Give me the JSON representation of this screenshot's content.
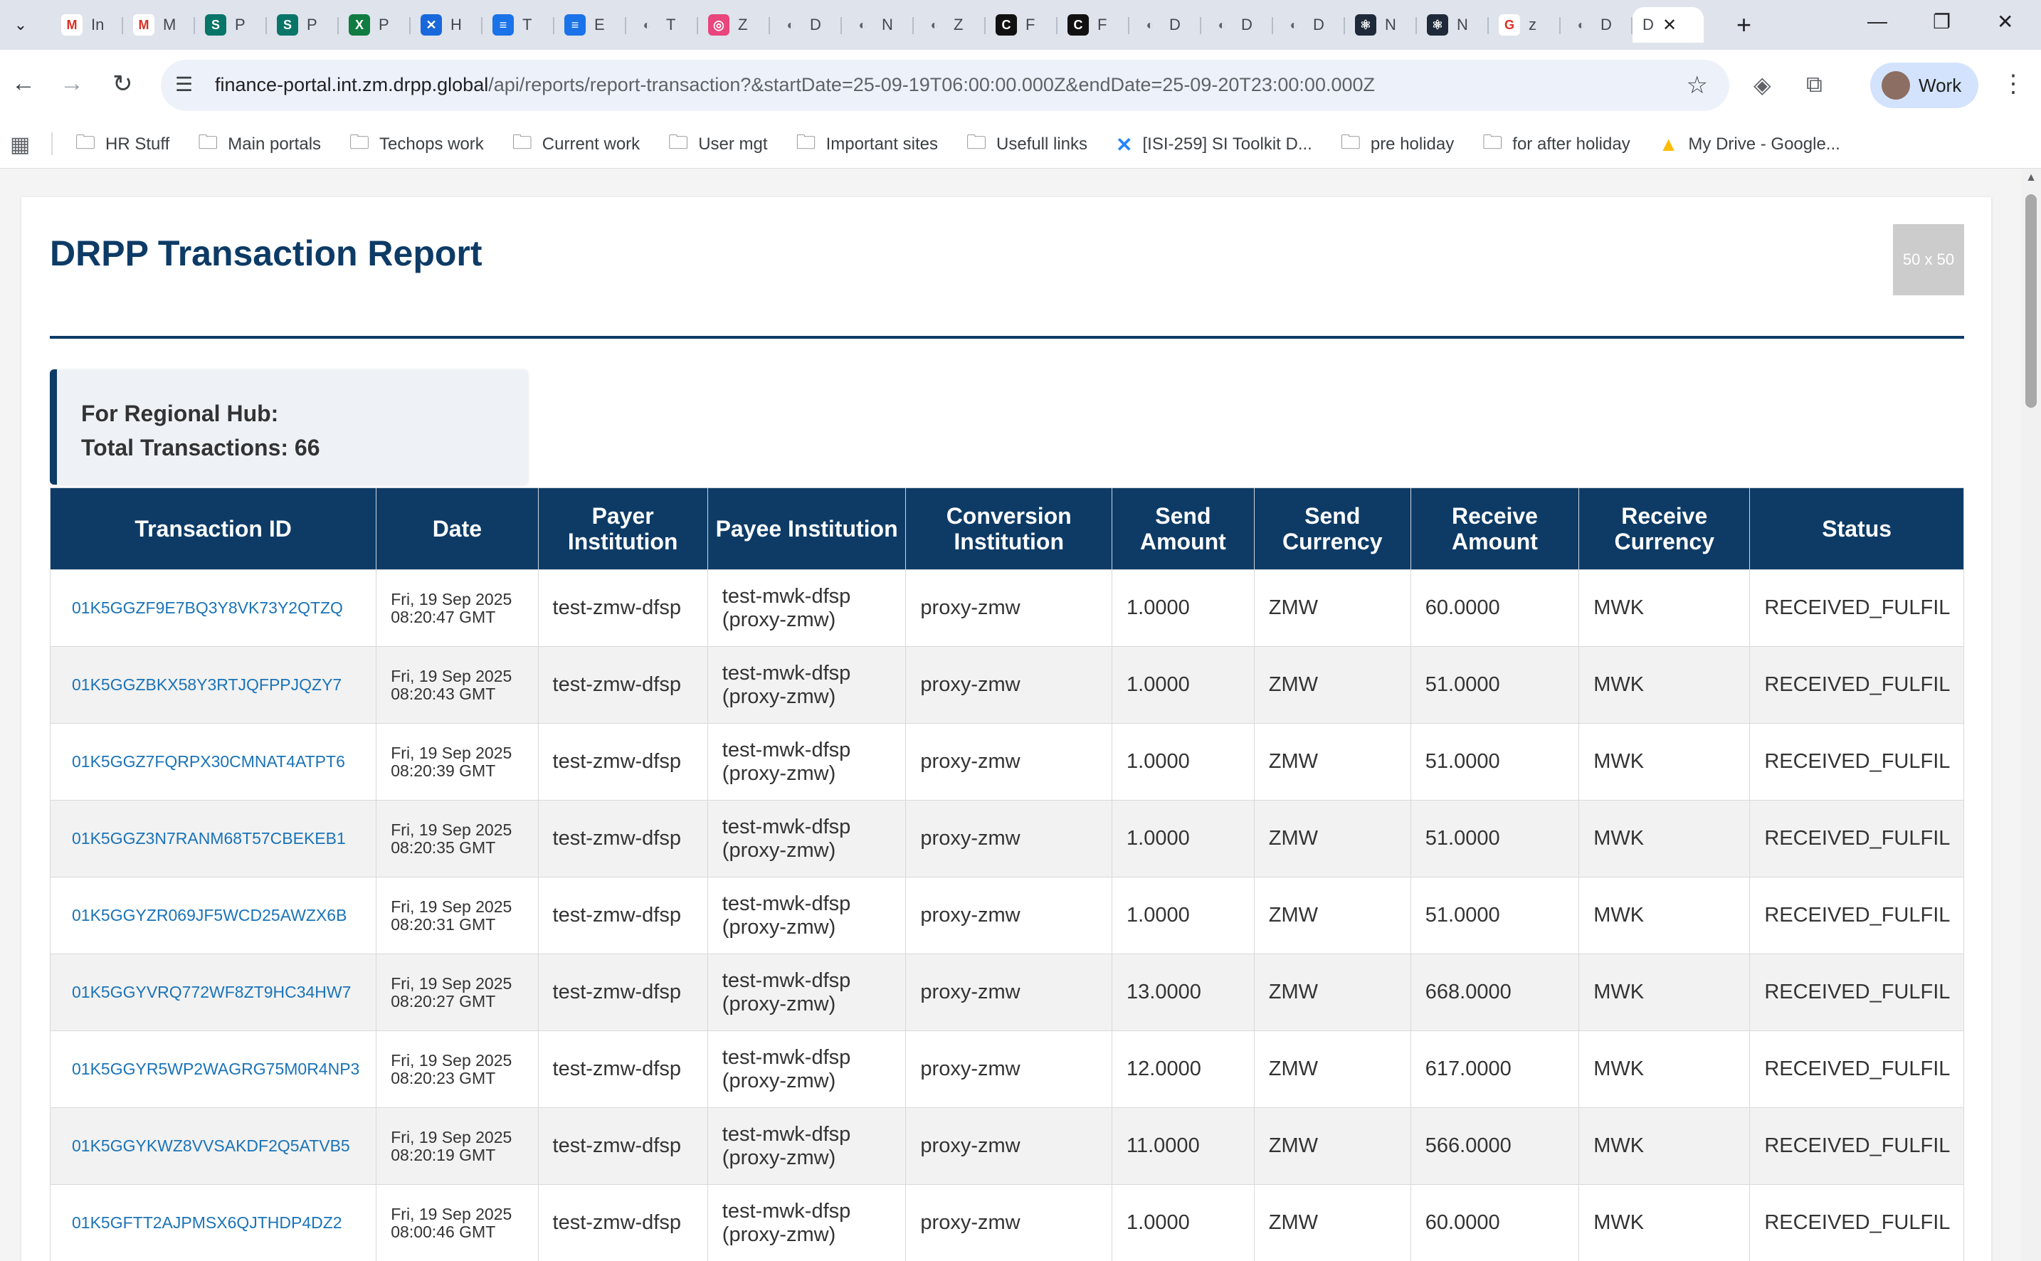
{
  "browser": {
    "tabs": [
      {
        "icon": "gmail-icon",
        "color": "#ffffff",
        "glyph": "M",
        "title": "In"
      },
      {
        "icon": "record-icon",
        "color": "#ffffff",
        "glyph": "M",
        "title": "M"
      },
      {
        "icon": "sharepoint-icon",
        "color": "#077568",
        "glyph": "S",
        "title": "P"
      },
      {
        "icon": "sharepoint-icon",
        "color": "#077568",
        "glyph": "S",
        "title": "P"
      },
      {
        "icon": "excel-icon",
        "color": "#107c41",
        "glyph": "X",
        "title": "P"
      },
      {
        "icon": "jira-icon",
        "color": "#1868db",
        "glyph": "✕",
        "title": "H"
      },
      {
        "icon": "doc-icon",
        "color": "#1a73e8",
        "glyph": "≡",
        "title": "T"
      },
      {
        "icon": "doc-icon",
        "color": "#1a73e8",
        "glyph": "≡",
        "title": "E"
      },
      {
        "icon": "globe-icon",
        "color": "#5f6368",
        "glyph": "◐",
        "title": "T"
      },
      {
        "icon": "app-icon",
        "color": "#e8467c",
        "glyph": "◎",
        "title": "Z"
      },
      {
        "icon": "globe-icon",
        "color": "#5f6368",
        "glyph": "◐",
        "title": "D"
      },
      {
        "icon": "globe-icon",
        "color": "#5f6368",
        "glyph": "◐",
        "title": "N"
      },
      {
        "icon": "globe-icon",
        "color": "#5f6368",
        "glyph": "◐",
        "title": "Z"
      },
      {
        "icon": "app-icon",
        "color": "#111111",
        "glyph": "C",
        "title": "F"
      },
      {
        "icon": "app-icon",
        "color": "#111111",
        "glyph": "C",
        "title": "F"
      },
      {
        "icon": "globe-icon",
        "color": "#5f6368",
        "glyph": "◐",
        "title": "D"
      },
      {
        "icon": "globe-icon",
        "color": "#5f6368",
        "glyph": "◐",
        "title": "D"
      },
      {
        "icon": "globe-icon",
        "color": "#5f6368",
        "glyph": "◐",
        "title": "D"
      },
      {
        "icon": "react-icon",
        "color": "#1e2a3a",
        "glyph": "⚛",
        "title": "N"
      },
      {
        "icon": "react-icon",
        "color": "#1e2a3a",
        "glyph": "⚛",
        "title": "N"
      },
      {
        "icon": "google-icon",
        "color": "#ffffff",
        "glyph": "G",
        "title": "z"
      },
      {
        "icon": "globe-icon",
        "color": "#5f6368",
        "glyph": "◐",
        "title": "D"
      }
    ],
    "active_tab_title": "D",
    "url_host": "finance-portal.int.zm.drpp.global",
    "url_path": "/api/reports/report-transaction?&startDate=25-09-19T06:00:00.000Z&endDate=25-09-20T23:00:00.000Z",
    "profile_label": "Work",
    "bookmarks": [
      {
        "icon": "folder-icon",
        "label": "HR Stuff"
      },
      {
        "icon": "folder-icon",
        "label": "Main portals"
      },
      {
        "icon": "folder-icon",
        "label": "Techops work"
      },
      {
        "icon": "folder-icon",
        "label": "Current work"
      },
      {
        "icon": "folder-icon",
        "label": "User mgt"
      },
      {
        "icon": "folder-icon",
        "label": "Important sites"
      },
      {
        "icon": "folder-icon",
        "label": "Usefull links"
      },
      {
        "icon": "jira-icon",
        "label": "[ISI-259] SI Toolkit D..."
      },
      {
        "icon": "folder-icon",
        "label": "pre holiday"
      },
      {
        "icon": "folder-icon",
        "label": "for after holiday"
      },
      {
        "icon": "drive-icon",
        "label": "My Drive - Google..."
      }
    ]
  },
  "report": {
    "title": "DRPP Transaction Report",
    "logo_placeholder": "50 x 50",
    "summary_hub": "For Regional Hub:",
    "summary_total": "Total Transactions: 66",
    "columns": [
      "Transaction ID",
      "Date",
      "Payer Institution",
      "Payee Institution",
      "Conversion Institution",
      "Send Amount",
      "Send Currency",
      "Receive Amount",
      "Receive Currency",
      "Status"
    ],
    "rows": [
      {
        "id": "01K5GGZF9E7BQ3Y8VK73Y2QTZQ",
        "date1": "Fri, 19 Sep 2025",
        "date2": "08:20:47 GMT",
        "payer": "test-zmw-dfsp",
        "payee1": "test-mwk-dfsp",
        "payee2": "(proxy-zmw)",
        "conversion": "proxy-zmw",
        "send_amount": "1.0000",
        "send_currency": "ZMW",
        "receive_amount": "60.0000",
        "receive_currency": "MWK",
        "status": "RECEIVED_FULFIL"
      },
      {
        "id": "01K5GGZBKX58Y3RTJQFPPJQZY7",
        "date1": "Fri, 19 Sep 2025",
        "date2": "08:20:43 GMT",
        "payer": "test-zmw-dfsp",
        "payee1": "test-mwk-dfsp",
        "payee2": "(proxy-zmw)",
        "conversion": "proxy-zmw",
        "send_amount": "1.0000",
        "send_currency": "ZMW",
        "receive_amount": "51.0000",
        "receive_currency": "MWK",
        "status": "RECEIVED_FULFIL"
      },
      {
        "id": "01K5GGZ7FQRPX30CMNAT4ATPT6",
        "date1": "Fri, 19 Sep 2025",
        "date2": "08:20:39 GMT",
        "payer": "test-zmw-dfsp",
        "payee1": "test-mwk-dfsp",
        "payee2": "(proxy-zmw)",
        "conversion": "proxy-zmw",
        "send_amount": "1.0000",
        "send_currency": "ZMW",
        "receive_amount": "51.0000",
        "receive_currency": "MWK",
        "status": "RECEIVED_FULFIL"
      },
      {
        "id": "01K5GGZ3N7RANM68T57CBEKEB1",
        "date1": "Fri, 19 Sep 2025",
        "date2": "08:20:35 GMT",
        "payer": "test-zmw-dfsp",
        "payee1": "test-mwk-dfsp",
        "payee2": "(proxy-zmw)",
        "conversion": "proxy-zmw",
        "send_amount": "1.0000",
        "send_currency": "ZMW",
        "receive_amount": "51.0000",
        "receive_currency": "MWK",
        "status": "RECEIVED_FULFIL"
      },
      {
        "id": "01K5GGYZR069JF5WCD25AWZX6B",
        "date1": "Fri, 19 Sep 2025",
        "date2": "08:20:31 GMT",
        "payer": "test-zmw-dfsp",
        "payee1": "test-mwk-dfsp",
        "payee2": "(proxy-zmw)",
        "conversion": "proxy-zmw",
        "send_amount": "1.0000",
        "send_currency": "ZMW",
        "receive_amount": "51.0000",
        "receive_currency": "MWK",
        "status": "RECEIVED_FULFIL"
      },
      {
        "id": "01K5GGYVRQ772WF8ZT9HC34HW7",
        "date1": "Fri, 19 Sep 2025",
        "date2": "08:20:27 GMT",
        "payer": "test-zmw-dfsp",
        "payee1": "test-mwk-dfsp",
        "payee2": "(proxy-zmw)",
        "conversion": "proxy-zmw",
        "send_amount": "13.0000",
        "send_currency": "ZMW",
        "receive_amount": "668.0000",
        "receive_currency": "MWK",
        "status": "RECEIVED_FULFIL"
      },
      {
        "id": "01K5GGYR5WP2WAGRG75M0R4NP3",
        "date1": "Fri, 19 Sep 2025",
        "date2": "08:20:23 GMT",
        "payer": "test-zmw-dfsp",
        "payee1": "test-mwk-dfsp",
        "payee2": "(proxy-zmw)",
        "conversion": "proxy-zmw",
        "send_amount": "12.0000",
        "send_currency": "ZMW",
        "receive_amount": "617.0000",
        "receive_currency": "MWK",
        "status": "RECEIVED_FULFIL"
      },
      {
        "id": "01K5GGYKWZ8VVSAKDF2Q5ATVB5",
        "date1": "Fri, 19 Sep 2025",
        "date2": "08:20:19 GMT",
        "payer": "test-zmw-dfsp",
        "payee1": "test-mwk-dfsp",
        "payee2": "(proxy-zmw)",
        "conversion": "proxy-zmw",
        "send_amount": "11.0000",
        "send_currency": "ZMW",
        "receive_amount": "566.0000",
        "receive_currency": "MWK",
        "status": "RECEIVED_FULFIL"
      },
      {
        "id": "01K5GFTT2AJPMSX6QJTHDP4DZ2",
        "date1": "Fri, 19 Sep 2025",
        "date2": "08:00:46 GMT",
        "payer": "test-zmw-dfsp",
        "payee1": "test-mwk-dfsp",
        "payee2": "(proxy-zmw)",
        "conversion": "proxy-zmw",
        "send_amount": "1.0000",
        "send_currency": "ZMW",
        "receive_amount": "60.0000",
        "receive_currency": "MWK",
        "status": "RECEIVED_FULFIL"
      }
    ]
  }
}
